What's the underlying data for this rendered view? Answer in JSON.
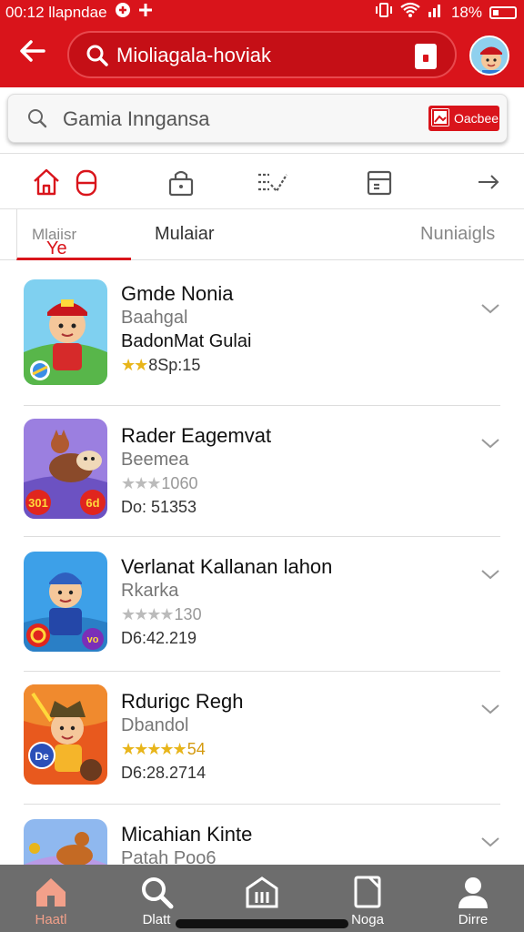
{
  "status": {
    "time_text": "00:12 llapndae",
    "battery_text": "18%"
  },
  "header": {
    "search_text": "Mioliagala-hoviak"
  },
  "search2": {
    "placeholder_text": "Gamia Inngansa",
    "button_label": "Oacbee"
  },
  "tabs": [
    {
      "label": "Ye",
      "sub": "Mlaiisr"
    },
    {
      "label": "Mulaiar"
    },
    {
      "label": "Nuniaigls"
    }
  ],
  "items": [
    {
      "title": "Gmde Nonia",
      "subtitle": "Baahgal",
      "line3": "BadonMat Gulai",
      "rating": "8Sp:15"
    },
    {
      "title": "Rader Eagemvat",
      "subtitle": "Beemea",
      "rating": "1060",
      "code": "Do: 51353"
    },
    {
      "title": "Verlanat Kallanan lahon",
      "subtitle": "Rkarka",
      "rating": "130",
      "code": "D6:42.219"
    },
    {
      "title": "Rdurigc Regh",
      "subtitle": "Dbandol",
      "rating": "54",
      "code": "D6:28.2714"
    },
    {
      "title": "Micahian Kinte",
      "subtitle": "Patah Poo6"
    }
  ],
  "badges": {
    "item2_left": "301",
    "item2_right": "6d",
    "item4_left": "De",
    "item3_right": "vo"
  },
  "bottomnav": [
    {
      "label": "Haatl"
    },
    {
      "label": "Dlatt"
    },
    {
      "label": ""
    },
    {
      "label": "Noga"
    },
    {
      "label": "Dirre"
    }
  ],
  "colors": {
    "brand_red": "#d9141b",
    "nav_grey": "#6d6d6d",
    "star": "#e8b51a"
  }
}
